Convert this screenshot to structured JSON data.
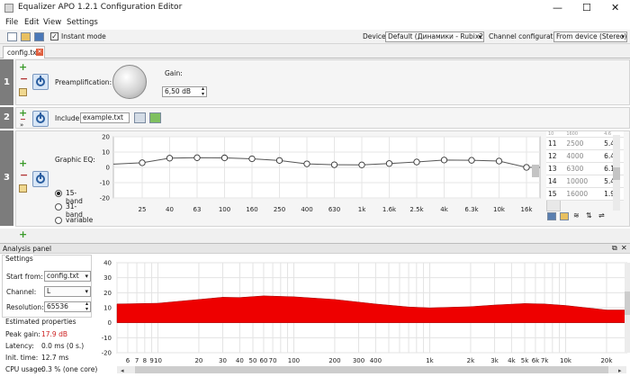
{
  "window": {
    "title": "Equalizer APO 1.2.1 Configuration Editor",
    "minimize": "—",
    "maximize": "☐",
    "close": "✕"
  },
  "menu": [
    "File",
    "Edit",
    "View",
    "Settings"
  ],
  "toolbar": {
    "instant_mode_label": "Instant mode",
    "instant_mode_checked": true,
    "device_label": "Device:",
    "device_value": "Default (Динамики - Rubix22)",
    "channel_config_label": "Channel configuration:",
    "channel_config_value": "From device (Stereo)"
  },
  "tabs": [
    {
      "label": "config.txt"
    }
  ],
  "filters": [
    {
      "number": "1",
      "name": "Preamplification:",
      "gain_label": "Gain:",
      "gain_value": "6,50 dB"
    },
    {
      "number": "2",
      "include_label": "Include:",
      "include_value": "example.txt"
    },
    {
      "number": "3",
      "name": "Graphic EQ:",
      "bands": [
        "15-band",
        "31-band",
        "variable"
      ],
      "selected_band": "15-band"
    }
  ],
  "graphic_eq": {
    "y_ticks": [
      "20",
      "10",
      "0",
      "-10",
      "-20"
    ],
    "ylim": [
      -20,
      20
    ],
    "x_labels": [
      "25",
      "40",
      "63",
      "100",
      "160",
      "250",
      "400",
      "630",
      "1k",
      "1.6k",
      "2.5k",
      "4k",
      "6.3k",
      "10k",
      "16k"
    ],
    "points": [
      3.0,
      6.0,
      6.3,
      6.2,
      5.6,
      4.5,
      2.3,
      1.7,
      1.6,
      2.5,
      3.5,
      4.8,
      4.6,
      4.1,
      0.0
    ],
    "table_rows": [
      {
        "idx": "11",
        "freq": "2500",
        "gain": "5.4"
      },
      {
        "idx": "12",
        "freq": "4000",
        "gain": "6.4"
      },
      {
        "idx": "13",
        "freq": "6300",
        "gain": "6.1"
      },
      {
        "idx": "14",
        "freq": "10000",
        "gain": "5.4"
      },
      {
        "idx": "15",
        "freq": "16000",
        "gain": "1.9"
      }
    ],
    "table_partial_row": {
      "idx": "10",
      "freq": "1600",
      "gain": "4.6"
    }
  },
  "analysis": {
    "title": "Analysis panel",
    "settings_heading": "Settings",
    "start_from_label": "Start from:",
    "start_from_value": "config.txt",
    "channel_label": "Channel:",
    "channel_value": "L",
    "resolution_label": "Resolution:",
    "resolution_value": "65536",
    "estimated_heading": "Estimated properties",
    "peak_gain_label": "Peak gain:",
    "peak_gain_value": "17.9 dB",
    "latency_label": "Latency:",
    "latency_value": "0.0 ms (0 s.)",
    "init_time_label": "Init. time:",
    "init_time_value": "12.7 ms",
    "cpu_label": "CPU usage:",
    "cpu_value": "0.3 % (one core)"
  },
  "chart_data": {
    "type": "area",
    "y_ticks": [
      "40",
      "30",
      "20",
      "10",
      "0",
      "-10",
      "-20"
    ],
    "ylim": [
      -20,
      40
    ],
    "x_tick_labels": [
      "6",
      "7",
      "8",
      "9",
      "10",
      "20",
      "30",
      "40",
      "50",
      "60",
      "70",
      "100",
      "200",
      "300",
      "400",
      "1k",
      "2k",
      "3k",
      "4k",
      "5k",
      "6k",
      "7k",
      "10k",
      "20k"
    ],
    "x_tick_values": [
      6,
      7,
      8,
      9,
      10,
      20,
      30,
      40,
      50,
      60,
      70,
      100,
      200,
      300,
      400,
      1000,
      2000,
      3000,
      4000,
      5000,
      6000,
      7000,
      10000,
      20000
    ],
    "series": [
      {
        "x": [
          5,
          10,
          20,
          30,
          40,
          60,
          100,
          200,
          400,
          700,
          1000,
          2000,
          3000,
          5000,
          7000,
          10000,
          20000,
          28000
        ],
        "y": [
          12.5,
          13.0,
          15.5,
          17.0,
          16.8,
          17.9,
          17.3,
          15.5,
          12.5,
          10.5,
          9.9,
          10.7,
          11.8,
          12.8,
          12.5,
          11.5,
          8.5,
          8.5
        ]
      }
    ],
    "colors": {
      "fill": "#ee0000"
    }
  }
}
